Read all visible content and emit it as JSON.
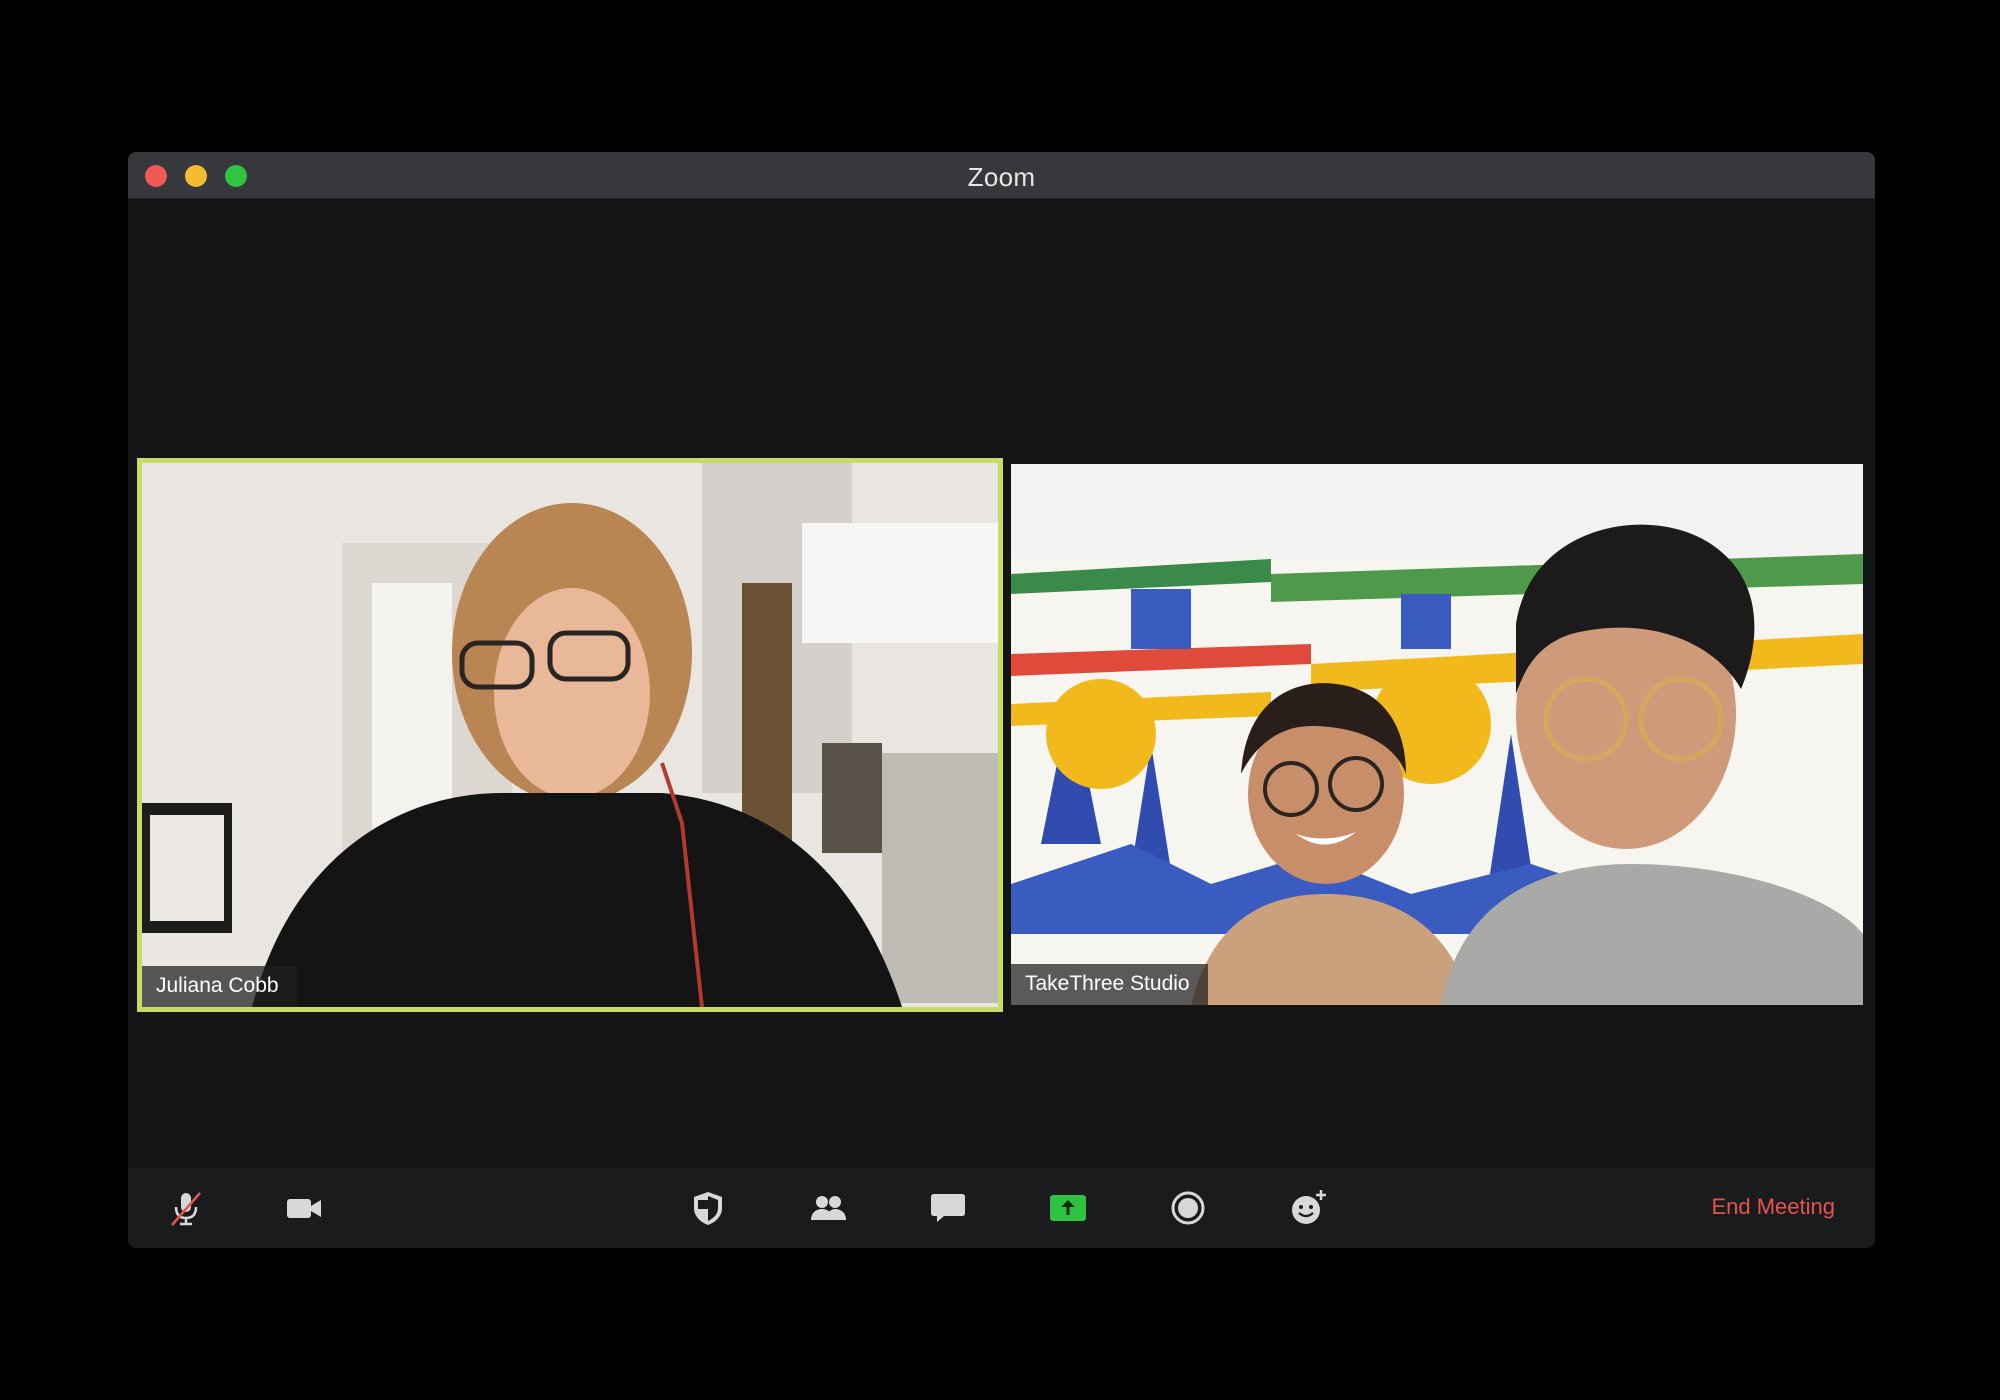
{
  "window": {
    "title": "Zoom"
  },
  "participants": [
    {
      "name": "Juliana Cobb",
      "active_speaker": true
    },
    {
      "name": "TakeThree Studio",
      "active_speaker": false
    }
  ],
  "toolbar": {
    "items": [
      {
        "icon": "microphone-muted-icon",
        "state": "muted"
      },
      {
        "icon": "video-camera-icon"
      },
      {
        "icon": "security-shield-icon"
      },
      {
        "icon": "participants-icon"
      },
      {
        "icon": "chat-bubble-icon"
      },
      {
        "icon": "share-screen-icon"
      },
      {
        "icon": "record-icon"
      },
      {
        "icon": "reactions-icon"
      }
    ],
    "end_meeting_label": "End Meeting"
  },
  "colors": {
    "active_speaker_border": "#c7db66",
    "end_meeting": "#e5534d",
    "share_screen": "#2ec241",
    "mute_slash": "#e5534d"
  }
}
